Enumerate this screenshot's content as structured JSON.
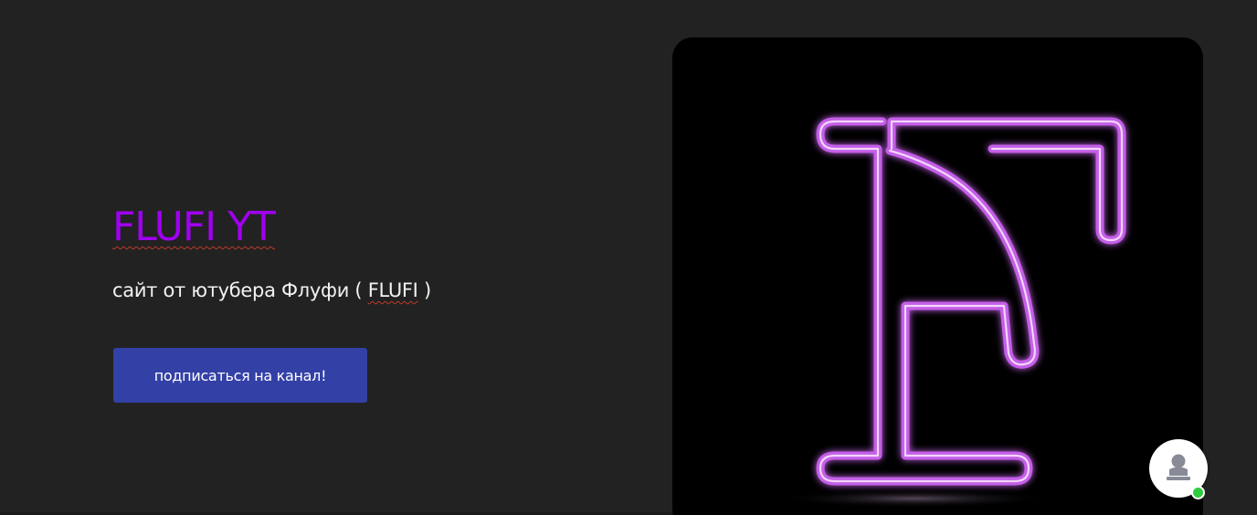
{
  "hero": {
    "title": "FLUFI YT",
    "subtitle_prefix": "сайт от ютубера Флуфи ( ",
    "subtitle_name": "FLUFI",
    "subtitle_suffix": " )",
    "cta_label": "подписаться на канал!"
  },
  "logo": {
    "icon": "neon-letter-f-logo"
  },
  "chat_widget": {
    "icon": "person-icon",
    "status": "online"
  },
  "colors": {
    "background": "#222222",
    "title": "#a000f0",
    "button": "#3340a6",
    "neon": "#d88cf0",
    "online": "#2ecc40"
  }
}
